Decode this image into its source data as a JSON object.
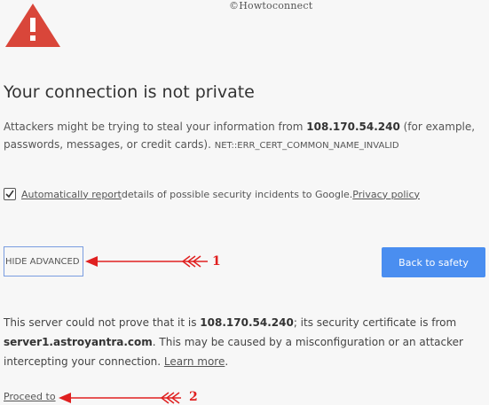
{
  "watermark": "©Howtoconnect",
  "page": {
    "title": "Your connection is not private",
    "desc_prefix": "Attackers might be trying to steal your information from ",
    "host": "108.170.54.240",
    "desc_suffix": " (for example, passwords, messages, or credit cards). ",
    "error_code": "NET::ERR_CERT_COMMON_NAME_INVALID"
  },
  "report": {
    "checked": true,
    "link_text": "Automatically report",
    "text": " details of possible security incidents to Google. ",
    "privacy_link": "Privacy policy"
  },
  "buttons": {
    "hide_advanced": "HIDE ADVANCED",
    "back_to_safety": "Back to safety"
  },
  "details": {
    "part1": "This server could not prove that it is ",
    "host": "108.170.54.240",
    "part2": "; its security certificate is from ",
    "issuer": "server1.astroyantra.com",
    "part3": ". This may be caused by a misconfiguration or an attacker intercepting your connection. ",
    "learn_more": "Learn more",
    "part4": "."
  },
  "proceed_link": "Proceed to",
  "annotations": {
    "label_1": "1",
    "label_2": "2",
    "color": "#e02020"
  },
  "colors": {
    "accent": "#4a8ef0",
    "warning": "#d9463a"
  }
}
